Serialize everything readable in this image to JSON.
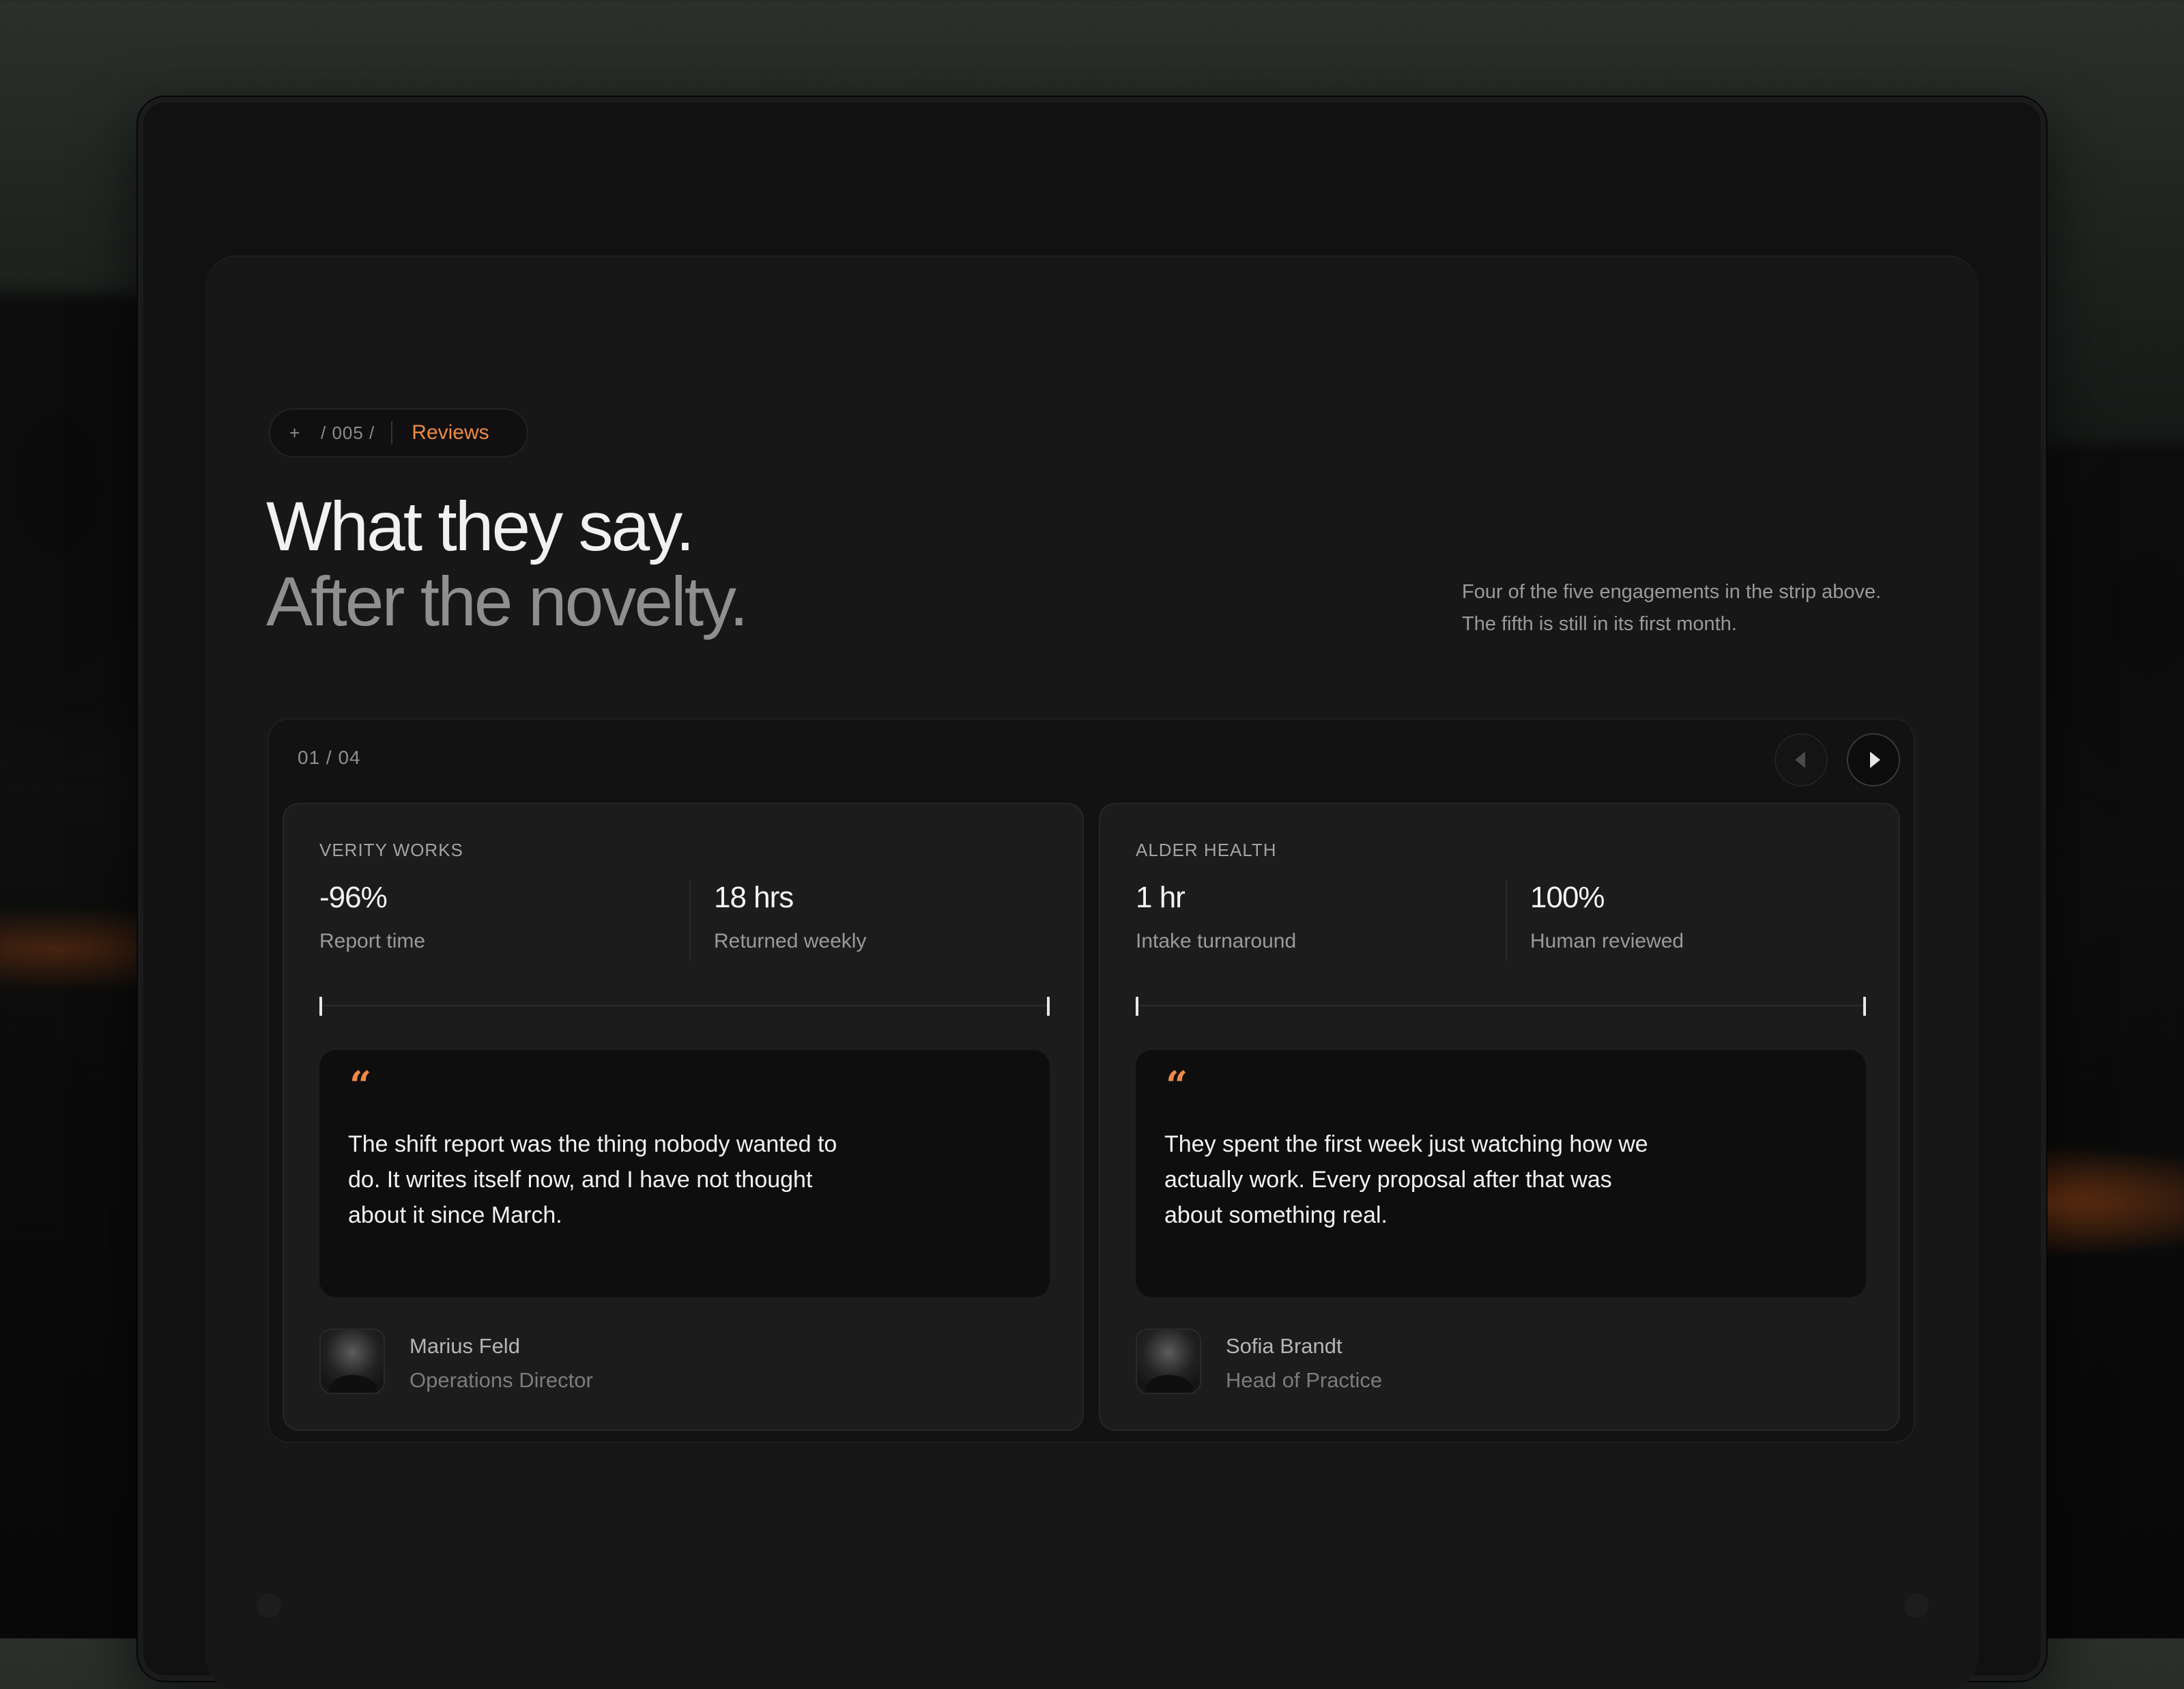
{
  "section_tag": {
    "plus": "+",
    "index": "/ 005 /",
    "label": "Reviews"
  },
  "heading": {
    "line1": "What they say.",
    "line2": "After the novelty."
  },
  "intro": "Four of the five engagements in the strip above. The fifth is still in its first month.",
  "carousel": {
    "counter": "01 / 04",
    "prev_icon": "chevron-left-icon",
    "next_icon": "chevron-right-icon",
    "cards": [
      {
        "company": "VERITY WORKS",
        "metrics": [
          {
            "value": "-96%",
            "label": "Report time"
          },
          {
            "value": "18 hrs",
            "label": "Returned weekly"
          }
        ],
        "quote_mark": "“",
        "quote": "The shift report was the thing nobody wanted to do. It writes itself now, and I have not thought about it since March.",
        "person": {
          "name": "Marius Feld",
          "role": "Operations Director"
        }
      },
      {
        "company": "ALDER HEALTH",
        "metrics": [
          {
            "value": "1 hr",
            "label": "Intake turnaround"
          },
          {
            "value": "100%",
            "label": "Human reviewed"
          }
        ],
        "quote_mark": "“",
        "quote": "They spent the first week just watching how we actually work. Every proposal after that was about something real.",
        "person": {
          "name": "Sofia Brandt",
          "role": "Head of Practice"
        }
      }
    ]
  },
  "colors": {
    "accent": "#ee8a45",
    "background": "#171717",
    "card": "#1c1c1c",
    "quote_box": "#0e0e0e"
  }
}
